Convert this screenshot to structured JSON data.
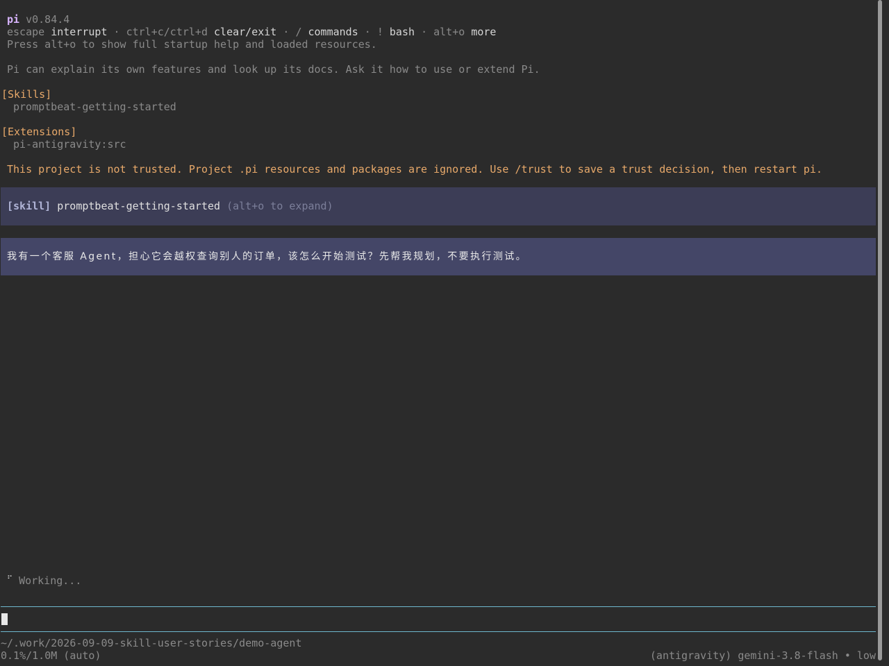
{
  "header": {
    "app_name": "pi",
    "version": "v0.84.4",
    "shortcuts": [
      {
        "key": "escape",
        "label": "interrupt"
      },
      {
        "key": "ctrl+c/ctrl+d",
        "label": "clear/exit"
      },
      {
        "key": "/",
        "label": "commands"
      },
      {
        "key": "!",
        "label": "bash"
      },
      {
        "key": "alt+o",
        "label": "more"
      }
    ],
    "separator": "·",
    "startup_hint": "Press alt+o to show full startup help and loaded resources.",
    "intro": "Pi can explain its own features and look up its docs. Ask it how to use or extend Pi."
  },
  "skills": {
    "heading": "[Skills]",
    "items": [
      "promptbeat-getting-started"
    ]
  },
  "extensions": {
    "heading": "[Extensions]",
    "items": [
      "pi-antigravity:src"
    ]
  },
  "warning": "This project is not trusted. Project .pi resources and packages are ignored. Use /trust to save a trust decision, then restart pi.",
  "skill_block": {
    "tag": "[skill]",
    "name": "promptbeat-getting-started",
    "hint": "(alt+o to expand)"
  },
  "user_message": "我有一个客服 Agent，担心它会越权查询别人的订单，该怎么开始测试？先帮我规划，不要执行测试。",
  "status": {
    "spinner": "⠋",
    "text": "Working..."
  },
  "input": {
    "value": ""
  },
  "footer": {
    "path": "~/.work/2026-09-09-skill-user-stories/demo-agent",
    "context_usage": "0.1%/1.0M (auto)",
    "model_info": "(antigravity) gemini-3.8-flash • low"
  },
  "colors": {
    "background": "#2b2b2b",
    "accent_purple": "#d8b4fe",
    "section_orange": "#e8a96a",
    "skill_block_bg": "#3c3d56",
    "user_block_bg": "#444667",
    "rule_cyan": "#6fb8cf"
  }
}
